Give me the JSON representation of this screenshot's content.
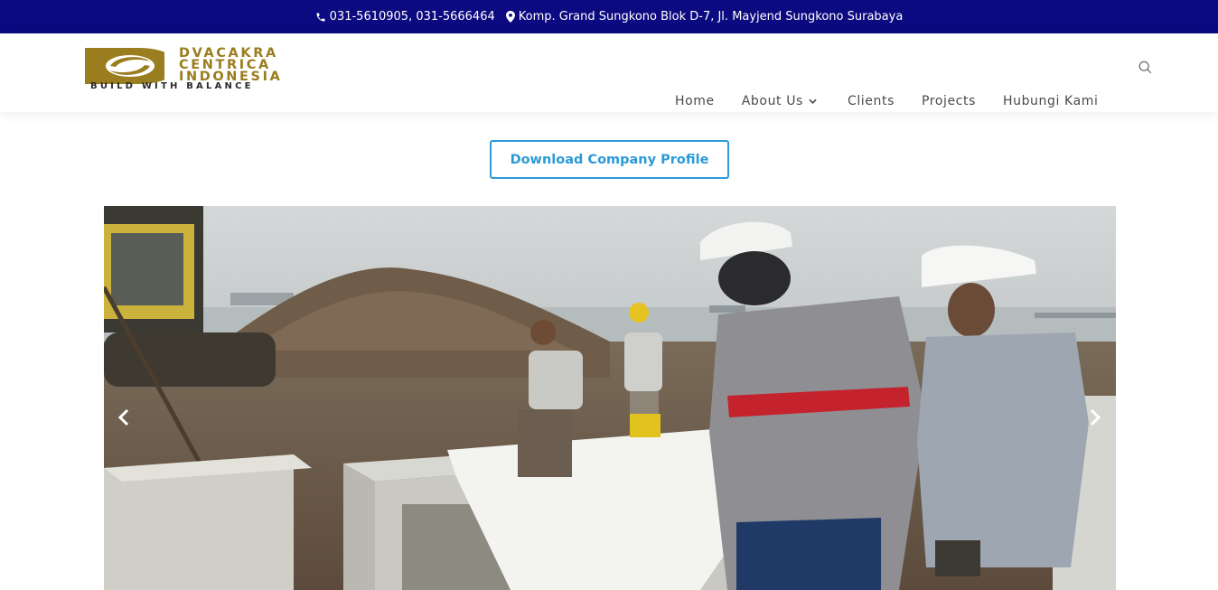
{
  "topbar": {
    "phone": "031-5610905, 031-5666464",
    "address": "Komp. Grand Sungkono Blok D-7, Jl. Mayjend Sungkono Surabaya"
  },
  "logo": {
    "line1": "DVACAKRA",
    "line2": "CENTRICA",
    "line3": "INDONESIA",
    "tagline": "BUILD WITH BALANCE"
  },
  "nav": {
    "items": [
      {
        "label": "Home"
      },
      {
        "label": "About Us"
      },
      {
        "label": "Clients"
      },
      {
        "label": "Projects"
      },
      {
        "label": "Hubungi Kami"
      }
    ]
  },
  "cta": {
    "label": "Download Company Profile"
  },
  "colors": {
    "topbar_bg": "#0c0a80",
    "accent": "#2b9ad6",
    "logo_gold": "#9a7d1e"
  },
  "icons": [
    "phone-icon",
    "map-marker-icon",
    "chevron-down-icon",
    "search-icon",
    "chevron-left-icon",
    "chevron-right-icon"
  ]
}
